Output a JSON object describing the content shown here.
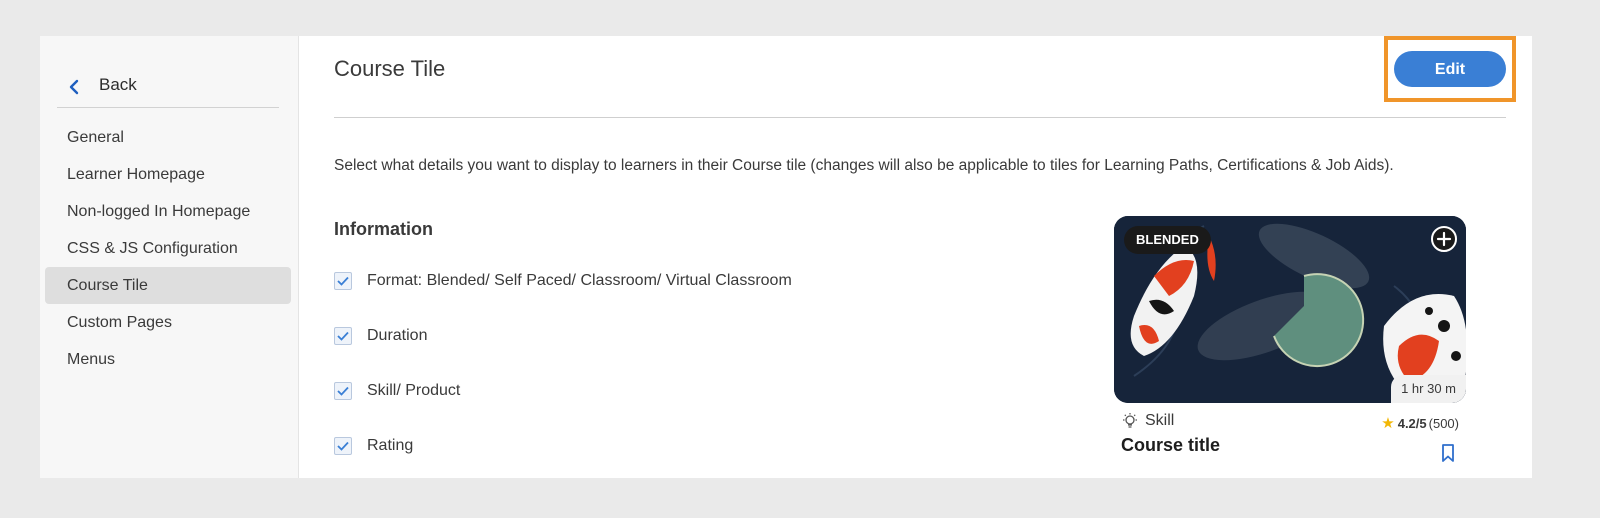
{
  "sidebar": {
    "back_label": "Back",
    "items": [
      {
        "label": "General"
      },
      {
        "label": "Learner Homepage"
      },
      {
        "label": "Non-logged In Homepage"
      },
      {
        "label": "CSS & JS Configuration"
      },
      {
        "label": "Course Tile",
        "active": true
      },
      {
        "label": "Custom Pages"
      },
      {
        "label": "Menus"
      }
    ]
  },
  "main": {
    "title": "Course Tile",
    "edit_label": "Edit",
    "description": "Select what details you want to display to learners in their Course tile (changes will also be applicable to tiles for Learning Paths, Certifications & Job Aids).",
    "section_title": "Information",
    "options": [
      {
        "label": "Format: Blended/ Self Paced/ Classroom/ Virtual Classroom",
        "checked": true
      },
      {
        "label": "Duration",
        "checked": true
      },
      {
        "label": "Skill/ Product",
        "checked": true
      },
      {
        "label": "Rating",
        "checked": true
      }
    ]
  },
  "tile": {
    "badge": "BLENDED",
    "duration": "1 hr 30 m",
    "skill": "Skill",
    "rating_score": "4.2/5",
    "rating_count": "(500)",
    "course_title": "Course title"
  },
  "colors": {
    "accent": "#3a7fd5",
    "highlight": "#f0952a",
    "star": "#f2b705"
  },
  "icons": {
    "back": "chevron-left-icon",
    "add": "plus-circle-icon",
    "skill": "bulb-icon",
    "bookmark": "bookmark-icon",
    "check": "checkmark-icon"
  }
}
